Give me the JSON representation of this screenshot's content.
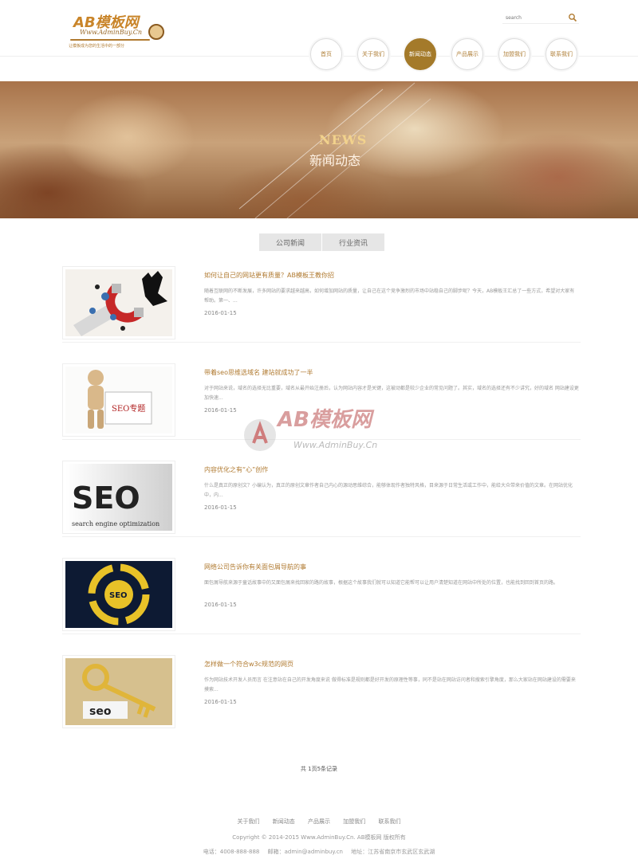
{
  "header": {
    "logo_main": "AB模板网",
    "logo_sub": "Www.AdminBuy.Cn",
    "logo_tagline": "让模板成为您的生活中的一部分",
    "search_placeholder": "search"
  },
  "nav": {
    "items": [
      {
        "label": "首页",
        "active": false
      },
      {
        "label": "关于我们",
        "active": false
      },
      {
        "label": "新闻动态",
        "active": true
      },
      {
        "label": "产品展示",
        "active": false
      },
      {
        "label": "加盟我们",
        "active": false
      },
      {
        "label": "联系我们",
        "active": false
      }
    ]
  },
  "banner": {
    "title_en": "NEWS",
    "title_cn": "新闻动态"
  },
  "tabs": [
    {
      "label": "公司新闻"
    },
    {
      "label": "行业资讯"
    }
  ],
  "news": [
    {
      "title": "如何让自己的网站更有质量？AB模板王教你招",
      "summary": "随着互联网的不断发展，许多网站的要求越来越高，如何增加网站的质量，让自己在这个竞争激烈的市场中站稳自己的脚步呢？今天，AB模板王汇总了一些方式，希望对大家有帮助。第一、...",
      "date": "2016-01-15",
      "thumb": "magnet"
    },
    {
      "title": "带着seo思维选域名 建站就成功了一半",
      "summary": "对于网站来说，域名的选择无比重要，域名从最开始注册后，认为网站内容才是关键，这被动都是较少企业的常见问题了。其实，域名的选择还有不少讲究，好的域名 网站建设更加快速...",
      "date": "2016-01-15",
      "thumb": "seo-figure"
    },
    {
      "title": "内容优化之有“心”创作",
      "summary": "什么是真正的原创文？小编认为，真正的原创文章作者自己内心的源动思维综合，能够体现作者独特风格，目来源于日常生活或工作中，能给大众带来价值的文章。在网站优化中，内...",
      "date": "2016-01-15",
      "thumb": "seo-3d"
    },
    {
      "title": "网络公司告诉你有关面包屑导航的事",
      "summary": "面包屑导航来源于童话故事中的又面包屑来找回家的路的故事，根据这个故事我们就可以知道它能帮可以让用户清楚知道在网站中所处的位置，也能找到回到首页的路。",
      "date": "2016-01-15",
      "thumb": "seo-cycle"
    },
    {
      "title": "怎样做一个符合w3c规范的网页",
      "summary": "作为网站技术开发人员而言 在注意站在自己的开发角度来说 做得标准是规则都是好开发的原理性等事，同不是站在网站访问者和搜索引擎角度，那么大家站在网站建设的需要来摸索...",
      "date": "2016-01-15",
      "thumb": "seo-key"
    }
  ],
  "watermark": {
    "main": "AB模板网",
    "sub": "Www.AdminBuy.Cn"
  },
  "pager": "共 1页5条记录",
  "footer": {
    "links": [
      "关于我们",
      "新闻动态",
      "产品展示",
      "加盟我们",
      "联系我们"
    ],
    "copyright": "Copyright © 2014-2015 Www.AdminBuy.Cn. AB模板网 版权所有",
    "phone": "电话：4008-888-888",
    "email": "邮箱：admin@adminbuy.cn",
    "address": "地址：江苏省南京市玄武区玄武湖"
  },
  "colors": {
    "accent": "#b07a30",
    "nav_active": "#a47a2a",
    "tab_bg": "#e6e6e6"
  }
}
